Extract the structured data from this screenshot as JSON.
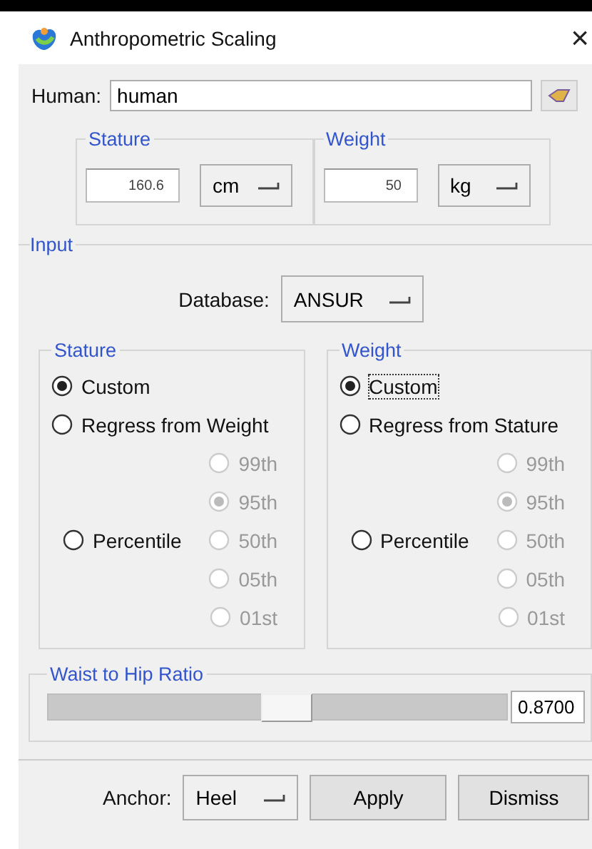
{
  "window": {
    "title": "Anthropometric Scaling",
    "close": "×"
  },
  "human": {
    "label": "Human:",
    "value": "human"
  },
  "measures": [
    {
      "legend": "Stature",
      "value": "160.6",
      "unit": "cm"
    },
    {
      "legend": "Weight",
      "value": "50",
      "unit": "kg"
    }
  ],
  "input": {
    "legend": "Input",
    "database": {
      "label": "Database:",
      "value": "ANSUR"
    }
  },
  "groups": [
    {
      "legend": "Stature",
      "options": [
        {
          "label": "Custom",
          "kind": "main",
          "selected": true,
          "focused": false
        },
        {
          "label": "Regress from Weight",
          "kind": "main",
          "selected": false,
          "focused": false
        },
        {
          "label": "Percentile",
          "kind": "percentile",
          "selected": false,
          "focused": false
        }
      ],
      "percentiles": [
        {
          "label": "99th",
          "selected": false,
          "disabled": true
        },
        {
          "label": "95th",
          "selected": true,
          "disabled": true
        },
        {
          "label": "50th",
          "selected": false,
          "disabled": true
        },
        {
          "label": "05th",
          "selected": false,
          "disabled": true
        },
        {
          "label": "01st",
          "selected": false,
          "disabled": true
        }
      ]
    },
    {
      "legend": "Weight",
      "options": [
        {
          "label": "Custom",
          "kind": "main",
          "selected": true,
          "focused": true
        },
        {
          "label": "Regress from Stature",
          "kind": "main",
          "selected": false,
          "focused": false
        },
        {
          "label": "Percentile",
          "kind": "percentile",
          "selected": false,
          "focused": false
        }
      ],
      "percentiles": [
        {
          "label": "99th",
          "selected": false,
          "disabled": true
        },
        {
          "label": "95th",
          "selected": true,
          "disabled": true
        },
        {
          "label": "50th",
          "selected": false,
          "disabled": true
        },
        {
          "label": "05th",
          "selected": false,
          "disabled": true
        },
        {
          "label": "01st",
          "selected": false,
          "disabled": true
        }
      ]
    }
  ],
  "ratio": {
    "legend": "Waist to Hip Ratio",
    "level": 0.52,
    "value": "0.8700"
  },
  "footer": {
    "anchor_label": "Anchor:",
    "anchor": "Heel",
    "buttons": [
      "Apply",
      "Dismiss"
    ]
  }
}
